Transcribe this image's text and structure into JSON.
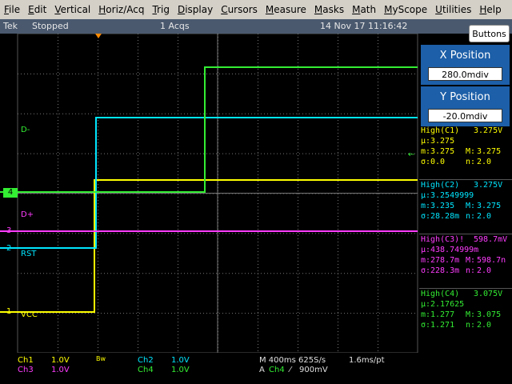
{
  "menu": [
    "File",
    "Edit",
    "Vertical",
    "Horiz/Acq",
    "Trig",
    "Display",
    "Cursors",
    "Measure",
    "Masks",
    "Math",
    "MyScope",
    "Utilities",
    "Help"
  ],
  "status": {
    "brand": "Tek",
    "state": "Stopped",
    "acqs": "1 Acqs",
    "datetime": "14 Nov 17 11:16:42"
  },
  "buttons_label": "Buttons",
  "x_position": {
    "title": "X Position",
    "value": "280.0mdiv"
  },
  "y_position": {
    "title": "Y Position",
    "value": "-20.0mdiv"
  },
  "measurements": [
    {
      "title": "High(C1)",
      "value": "3.275V",
      "mu_label": "µ:",
      "mu": "3.275",
      "m_label": "m:",
      "m": "3.275",
      "M_label": "M:",
      "M": "3.275",
      "sigma_label": "σ:",
      "sigma": "0.0",
      "n_label": "n:",
      "n": "2.0",
      "color": "#ffff00"
    },
    {
      "title": "High(C2)",
      "value": "3.275V",
      "mu_label": "µ:",
      "mu": "3.2549999",
      "m_label": "m:",
      "m": "3.235",
      "M_label": "M:",
      "M": "3.275",
      "sigma_label": "σ:",
      "sigma": "28.28m",
      "n_label": "n:",
      "n": "2.0",
      "color": "#00e6ff"
    },
    {
      "title": "High(C3)!",
      "value": "598.7mV",
      "mu_label": "µ:",
      "mu": "438.74999m",
      "m_label": "m:",
      "m": "278.7m",
      "M_label": "M:",
      "M": "598.7n",
      "sigma_label": "σ:",
      "sigma": "228.3m",
      "n_label": "n:",
      "n": "2.0",
      "color": "#ff3cff"
    },
    {
      "title": "High(C4)",
      "value": "3.075V",
      "mu_label": "µ:",
      "mu": "2.17625",
      "m_label": "m:",
      "m": "1.277",
      "M_label": "M:",
      "M": "3.075",
      "sigma_label": "σ:",
      "sigma": "1.271",
      "n_label": "n:",
      "n": "2.0",
      "color": "#33ee33"
    }
  ],
  "channel_labels": {
    "d_minus": "D-",
    "d_plus": "D+",
    "rst": "RST",
    "vcc": "VCC"
  },
  "channel_markers": {
    "ch4": "4",
    "ch3": "3",
    "ch2": "2",
    "ch1": "1"
  },
  "bottom": {
    "ch1": "Ch1",
    "ch1_scale": "1.0V",
    "ch3": "Ch3",
    "ch3_scale": "1.0V",
    "bw": "Bw",
    "ch2": "Ch2",
    "ch2_scale": "1.0V",
    "ch4": "Ch4",
    "ch4_scale": "1.0V",
    "timebase": "M 400ms 625S/s",
    "pt": "1.6ms/pt",
    "trigger_prefix": "A",
    "trigger_src": "Ch4",
    "trigger_slope": "⁄",
    "trigger_level": "900mV"
  },
  "colors": {
    "ch1": "#ffff00",
    "ch2": "#00e6ff",
    "ch3": "#ff3cff",
    "ch4": "#33ee33",
    "panel": "#1d5fa8",
    "status": "#4a596e"
  },
  "traces": {
    "ch1": [
      [
        0,
        390
      ],
      [
        118,
        390
      ],
      [
        118,
        225
      ],
      [
        122,
        225
      ],
      [
        522,
        225
      ]
    ],
    "ch2": [
      [
        0,
        310
      ],
      [
        120,
        310
      ],
      [
        120,
        147
      ],
      [
        522,
        147
      ]
    ],
    "ch3": [
      [
        0,
        289
      ],
      [
        522,
        289
      ]
    ],
    "ch4": [
      [
        0,
        240
      ],
      [
        256,
        240
      ],
      [
        256,
        84
      ],
      [
        522,
        84
      ]
    ]
  }
}
